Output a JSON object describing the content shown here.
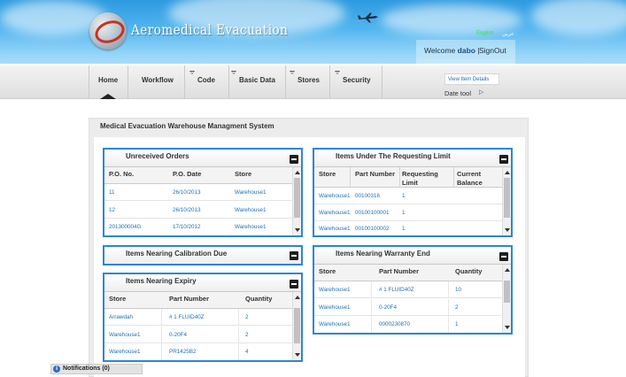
{
  "header": {
    "brand": "Aeromedical Evacuation",
    "lang_en": "English",
    "lang_ar": "عربي",
    "welcome_prefix": "Welcome",
    "username": "dabo",
    "separator": "|",
    "signout": "SignOut"
  },
  "nav": {
    "items": [
      {
        "label": "Home",
        "dropdown": false,
        "active": true
      },
      {
        "label": "Workflow",
        "dropdown": false
      },
      {
        "label": "Code",
        "dropdown": true
      },
      {
        "label": "Basic Data",
        "dropdown": true
      },
      {
        "label": "Stores",
        "dropdown": true
      },
      {
        "label": "Security",
        "dropdown": true
      }
    ],
    "view_item_details": "View Item Details",
    "date_tool": "Date tool"
  },
  "main": {
    "title": "Medical Evacuation Warehouse Managment System"
  },
  "panels": {
    "unreceived_orders": {
      "title": "Unreceived Orders",
      "columns": [
        "P.O. No.",
        "P.O. Date",
        "Store"
      ],
      "rows": [
        [
          "11",
          "26/10/2013",
          "Warehouse1"
        ],
        [
          "12",
          "26/10/2013",
          "Warehouse1"
        ],
        [
          "201300004G",
          "17/10/2012",
          "Warehouse1"
        ]
      ]
    },
    "requesting_limit": {
      "title": "Items Under The Requesting Limit",
      "columns": [
        "Store",
        "Part Number",
        "Requesting Limit",
        "Current Balance"
      ],
      "rows": [
        [
          "Warehouse1",
          "00100316",
          "1",
          ""
        ],
        [
          "Warehouse1",
          "00100100001",
          "1",
          ""
        ],
        [
          "Warehouse1",
          "00100100002",
          "1",
          ""
        ]
      ]
    },
    "calibration_due": {
      "title": "Items Nearing Calibration Due"
    },
    "warranty_end": {
      "title": "Items Nearing Warranty End",
      "columns": [
        "Store",
        "Part Number",
        "Quantity"
      ],
      "rows": [
        [
          "Warehouse1",
          "# 1 FLUID40Z",
          "10"
        ],
        [
          "Warehouse1",
          "0-20F4",
          "2"
        ],
        [
          "Warehouse1",
          "0000230870",
          "1"
        ]
      ]
    },
    "nearing_expiry": {
      "title": "Items Nearing Expiry",
      "columns": [
        "Store",
        "Part Number",
        "Quantity"
      ],
      "rows": [
        [
          "Arrawdah",
          "# 1 FLUID40Z",
          "2"
        ],
        [
          "Warehouse1",
          "0-20F4",
          "2"
        ],
        [
          "Warehouse1",
          "PR1425B2",
          "4"
        ]
      ]
    }
  },
  "notifications": {
    "icon_glyph": "i",
    "label": "Notifications (0)"
  },
  "colors": {
    "panel_border": "#2d86d6",
    "link": "#1e6fb6",
    "header_sky": "#52b5ef",
    "english_link": "#3be23b"
  }
}
